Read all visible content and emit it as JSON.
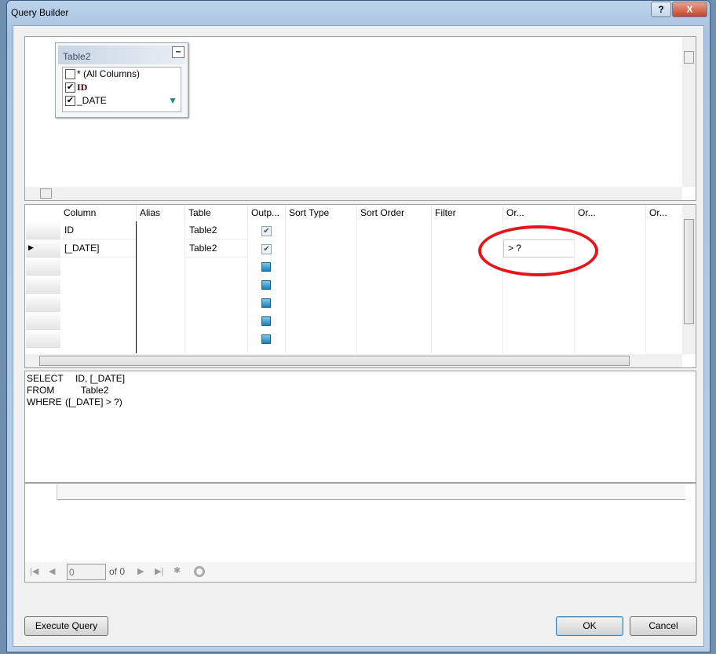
{
  "window": {
    "title": "Query Builder",
    "help_label": "?",
    "close_label": "X"
  },
  "diagram": {
    "table": {
      "name": "Table2",
      "minimize_label": "–",
      "columns": [
        {
          "label": "* (All Columns)",
          "checked": false
        },
        {
          "label": "ID",
          "checked": true,
          "key": true
        },
        {
          "label": "_DATE",
          "checked": true,
          "filtered": true
        }
      ]
    }
  },
  "grid": {
    "headers": [
      "Column",
      "Alias",
      "Table",
      "Outp...",
      "Sort Type",
      "Sort Order",
      "Filter",
      "Or...",
      "Or...",
      "Or..."
    ],
    "rows": [
      {
        "column": "ID",
        "alias": "",
        "table": "Table2",
        "output": true,
        "filter": "",
        "or1": ""
      },
      {
        "column": "[_DATE]",
        "alias": "",
        "table": "Table2",
        "output": true,
        "filter": "",
        "or1": "> ?",
        "current": true
      }
    ],
    "empty_rows": 5
  },
  "sql": {
    "lines": [
      {
        "kw": "SELECT",
        "text": "ID, [_DATE]"
      },
      {
        "kw": "FROM",
        "text": "Table2"
      },
      {
        "kw": "WHERE",
        "text": "([_DATE] > ?)"
      }
    ]
  },
  "results": {
    "nav": {
      "position": "0",
      "of_label": "of 0"
    }
  },
  "buttons": {
    "execute": "Execute Query",
    "ok": "OK",
    "cancel": "Cancel"
  },
  "annotation": {
    "color": "#e8141c"
  }
}
